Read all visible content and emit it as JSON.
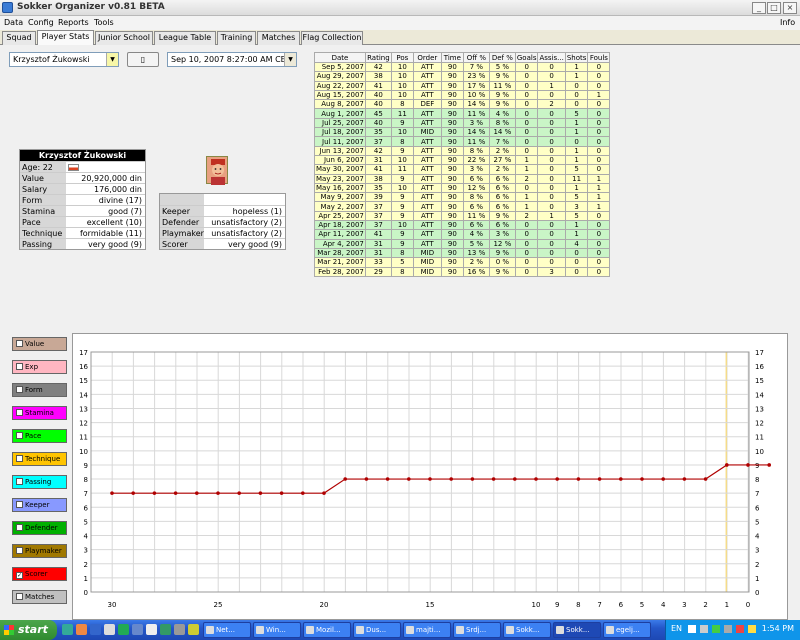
{
  "window": {
    "title": "Sokker Organizer v0.81 BETA"
  },
  "menu": {
    "items": [
      "Data",
      "Config",
      "Reports",
      "Tools"
    ],
    "info": "Info"
  },
  "tabs": [
    "Squad",
    "Player Stats",
    "Junior School",
    "League Table",
    "Training",
    "Matches",
    "Flag Collection"
  ],
  "player_select": {
    "value": "Krzysztof Żukowski"
  },
  "date_select": {
    "value": "Sep 10, 2007 8:27:00 AM CEST"
  },
  "player": {
    "name": "Krzysztof Żukowski",
    "rows": [
      {
        "k": "Age: 22",
        "v": ""
      },
      {
        "k": "Value",
        "v": "20,920,000 din"
      },
      {
        "k": "Salary",
        "v": "176,000 din"
      },
      {
        "k": "Form",
        "v": "divine (17)"
      },
      {
        "k": "Stamina",
        "v": "good (7)"
      },
      {
        "k": "Pace",
        "v": "excellent (10)"
      },
      {
        "k": "Technique",
        "v": "formidable (11)"
      },
      {
        "k": "Passing",
        "v": "very good (9)"
      }
    ],
    "skills": [
      {
        "k": "Keeper",
        "v": "hopeless (1)"
      },
      {
        "k": "Defender",
        "v": "unsatisfactory (2)"
      },
      {
        "k": "Playmaker",
        "v": "unsatisfactory (2)"
      },
      {
        "k": "Scorer",
        "v": "very good (9)"
      }
    ]
  },
  "stats": {
    "headers": [
      "Date",
      "Rating",
      "Pos",
      "Order",
      "Time",
      "Off %",
      "Def %",
      "Goals",
      "Assis...",
      "Shots",
      "Fouls"
    ],
    "rows": [
      [
        "Sep 5, 2007",
        "42",
        "10",
        "ATT",
        "90",
        "7 %",
        "5 %",
        "0",
        "0",
        "1",
        "0"
      ],
      [
        "Aug 29, 2007",
        "38",
        "10",
        "ATT",
        "90",
        "23 %",
        "9 %",
        "0",
        "0",
        "1",
        "0"
      ],
      [
        "Aug 22, 2007",
        "41",
        "10",
        "ATT",
        "90",
        "17 %",
        "11 %",
        "0",
        "1",
        "0",
        "0"
      ],
      [
        "Aug 15, 2007",
        "40",
        "10",
        "ATT",
        "90",
        "10 %",
        "9 %",
        "0",
        "0",
        "0",
        "1"
      ],
      [
        "Aug 8, 2007",
        "40",
        "8",
        "DEF",
        "90",
        "14 %",
        "9 %",
        "0",
        "2",
        "0",
        "0"
      ],
      [
        "Aug 1, 2007",
        "45",
        "11",
        "ATT",
        "90",
        "11 %",
        "4 %",
        "0",
        "0",
        "5",
        "0"
      ],
      [
        "Jul 25, 2007",
        "40",
        "9",
        "ATT",
        "90",
        "3 %",
        "8 %",
        "0",
        "0",
        "1",
        "0"
      ],
      [
        "Jul 18, 2007",
        "35",
        "10",
        "MID",
        "90",
        "14 %",
        "14 %",
        "0",
        "0",
        "1",
        "0"
      ],
      [
        "Jul 11, 2007",
        "37",
        "8",
        "ATT",
        "90",
        "11 %",
        "7 %",
        "0",
        "0",
        "0",
        "0"
      ],
      [
        "Jun 13, 2007",
        "42",
        "9",
        "ATT",
        "90",
        "8 %",
        "2 %",
        "0",
        "0",
        "1",
        "0"
      ],
      [
        "Jun 6, 2007",
        "31",
        "10",
        "ATT",
        "90",
        "22 %",
        "27 %",
        "1",
        "0",
        "1",
        "0"
      ],
      [
        "May 30, 2007",
        "41",
        "11",
        "ATT",
        "90",
        "3 %",
        "2 %",
        "1",
        "0",
        "5",
        "0"
      ],
      [
        "May 23, 2007",
        "38",
        "9",
        "ATT",
        "90",
        "6 %",
        "6 %",
        "2",
        "0",
        "11",
        "1"
      ],
      [
        "May 16, 2007",
        "35",
        "10",
        "ATT",
        "90",
        "12 %",
        "6 %",
        "0",
        "0",
        "1",
        "1"
      ],
      [
        "May 9, 2007",
        "39",
        "9",
        "ATT",
        "90",
        "8 %",
        "6 %",
        "1",
        "0",
        "5",
        "1"
      ],
      [
        "May 2, 2007",
        "37",
        "9",
        "ATT",
        "90",
        "6 %",
        "6 %",
        "1",
        "0",
        "3",
        "1"
      ],
      [
        "Apr 25, 2007",
        "37",
        "9",
        "ATT",
        "90",
        "11 %",
        "9 %",
        "2",
        "1",
        "5",
        "0"
      ],
      [
        "Apr 18, 2007",
        "37",
        "10",
        "ATT",
        "90",
        "6 %",
        "6 %",
        "0",
        "0",
        "1",
        "0"
      ],
      [
        "Apr 11, 2007",
        "41",
        "9",
        "ATT",
        "90",
        "4 %",
        "3 %",
        "0",
        "0",
        "1",
        "0"
      ],
      [
        "Apr 4, 2007",
        "31",
        "9",
        "ATT",
        "90",
        "5 %",
        "12 %",
        "0",
        "0",
        "4",
        "0"
      ],
      [
        "Mar 28, 2007",
        "31",
        "8",
        "MID",
        "90",
        "13 %",
        "9 %",
        "0",
        "0",
        "0",
        "0"
      ],
      [
        "Mar 21, 2007",
        "33",
        "5",
        "MID",
        "90",
        "2 %",
        "0 %",
        "0",
        "0",
        "0",
        "0"
      ],
      [
        "Feb 28, 2007",
        "29",
        "8",
        "MID",
        "90",
        "16 %",
        "9 %",
        "0",
        "3",
        "0",
        "0"
      ]
    ],
    "row_colors": [
      "y",
      "y",
      "y",
      "y",
      "y",
      "g",
      "g",
      "g",
      "g",
      "y",
      "y",
      "y",
      "y",
      "y",
      "y",
      "y",
      "y",
      "g",
      "g",
      "g",
      "g",
      "y",
      "y"
    ]
  },
  "legend": [
    {
      "label": "Value",
      "color": "#c8a896",
      "checked": false
    },
    {
      "label": "Exp",
      "color": "#ffb6c1",
      "checked": false
    },
    {
      "label": "Form",
      "color": "#808080",
      "checked": false
    },
    {
      "label": "Stamina",
      "color": "#ff00ff",
      "checked": false
    },
    {
      "label": "Pace",
      "color": "#00ff00",
      "checked": false
    },
    {
      "label": "Technique",
      "color": "#ffc400",
      "checked": false
    },
    {
      "label": "Passing",
      "color": "#00ffff",
      "checked": false
    },
    {
      "label": "Keeper",
      "color": "#8899ff",
      "checked": false
    },
    {
      "label": "Defender",
      "color": "#00b000",
      "checked": false
    },
    {
      "label": "Playmaker",
      "color": "#a07800",
      "checked": false
    },
    {
      "label": "Scorer",
      "color": "#ff0000",
      "checked": true
    },
    {
      "label": "Matches",
      "color": "#c0c0c0",
      "checked": false
    }
  ],
  "chart_data": {
    "type": "line",
    "series": [
      {
        "name": "Scorer",
        "color": "#b00000",
        "values": [
          7,
          7,
          7,
          7,
          7,
          7,
          7,
          7,
          7,
          7,
          7,
          8,
          8,
          8,
          8,
          8,
          8,
          8,
          8,
          8,
          8,
          8,
          8,
          8,
          8,
          8,
          8,
          8,
          8,
          9,
          9,
          9
        ]
      }
    ],
    "x_ticks": [
      "30",
      "25",
      "20",
      "15",
      "10",
      "9",
      "8",
      "7",
      "6",
      "5",
      "4",
      "3",
      "2",
      "1",
      "0"
    ],
    "ylim": [
      0,
      17
    ],
    "y_ticks": [
      "0",
      "1",
      "2",
      "3",
      "4",
      "5",
      "6",
      "7",
      "8",
      "9",
      "10",
      "11",
      "12",
      "13",
      "14",
      "15",
      "16",
      "17"
    ],
    "grid": true,
    "highlight_tick": "2"
  },
  "taskbar": {
    "start": "start",
    "buttons": [
      "Net...",
      "Win...",
      "Mozil...",
      "Dus...",
      "majti...",
      "Srdj...",
      "Sokk...",
      "Sokk...",
      "egelj..."
    ],
    "active_index": 7,
    "lang": "EN",
    "clock": "1:54 PM"
  }
}
